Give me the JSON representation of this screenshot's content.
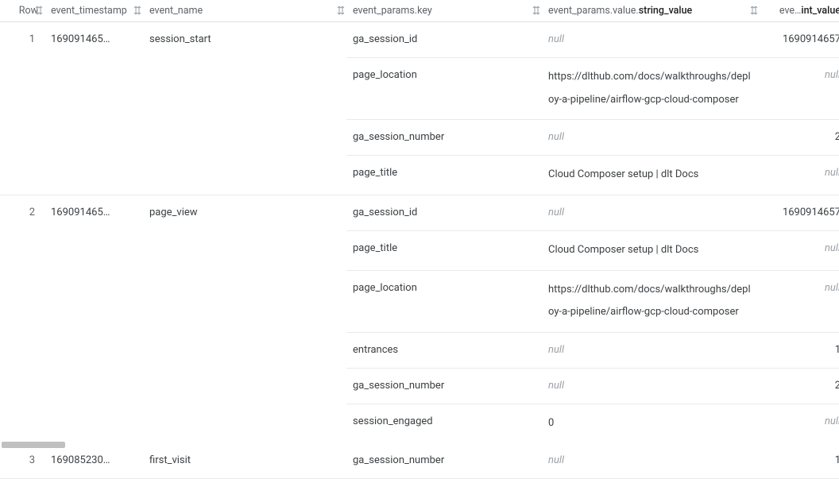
{
  "columns": {
    "row": "Row",
    "event_timestamp": "event_timestamp",
    "event_name": "event_name",
    "event_params_key": "event_params.key",
    "event_params_string_value_prefix": "event_params.value.",
    "event_params_string_value_bold": "string_value",
    "event_params_int_value_prefix": "eve…",
    "event_params_int_value_bold": "int_value"
  },
  "null_text": "null",
  "rows": [
    {
      "row": "1",
      "timestamp": "169091465…",
      "event_name": "session_start",
      "params": [
        {
          "key": "ga_session_id",
          "string_value": null,
          "int_value": "1690914657"
        },
        {
          "key": "page_location",
          "string_value": "https://dlthub.com/docs/walkthroughs/deploy-a-pipeline/airflow-gcp-cloud-composer",
          "int_value": null
        },
        {
          "key": "ga_session_number",
          "string_value": null,
          "int_value": "2"
        },
        {
          "key": "page_title",
          "string_value": "Cloud Composer setup | dlt Docs",
          "int_value": null
        }
      ]
    },
    {
      "row": "2",
      "timestamp": "169091465…",
      "event_name": "page_view",
      "params": [
        {
          "key": "ga_session_id",
          "string_value": null,
          "int_value": "1690914657"
        },
        {
          "key": "page_title",
          "string_value": "Cloud Composer setup | dlt Docs",
          "int_value": null
        },
        {
          "key": "page_location",
          "string_value": "https://dlthub.com/docs/walkthroughs/deploy-a-pipeline/airflow-gcp-cloud-composer",
          "int_value": null
        },
        {
          "key": "entrances",
          "string_value": null,
          "int_value": "1"
        },
        {
          "key": "ga_session_number",
          "string_value": null,
          "int_value": "2"
        },
        {
          "key": "session_engaged",
          "string_value": "0",
          "int_value": null
        }
      ]
    },
    {
      "row": "3",
      "timestamp": "169085230…",
      "event_name": "first_visit",
      "params": [
        {
          "key": "ga_session_number",
          "string_value": null,
          "int_value": "1"
        }
      ]
    }
  ]
}
